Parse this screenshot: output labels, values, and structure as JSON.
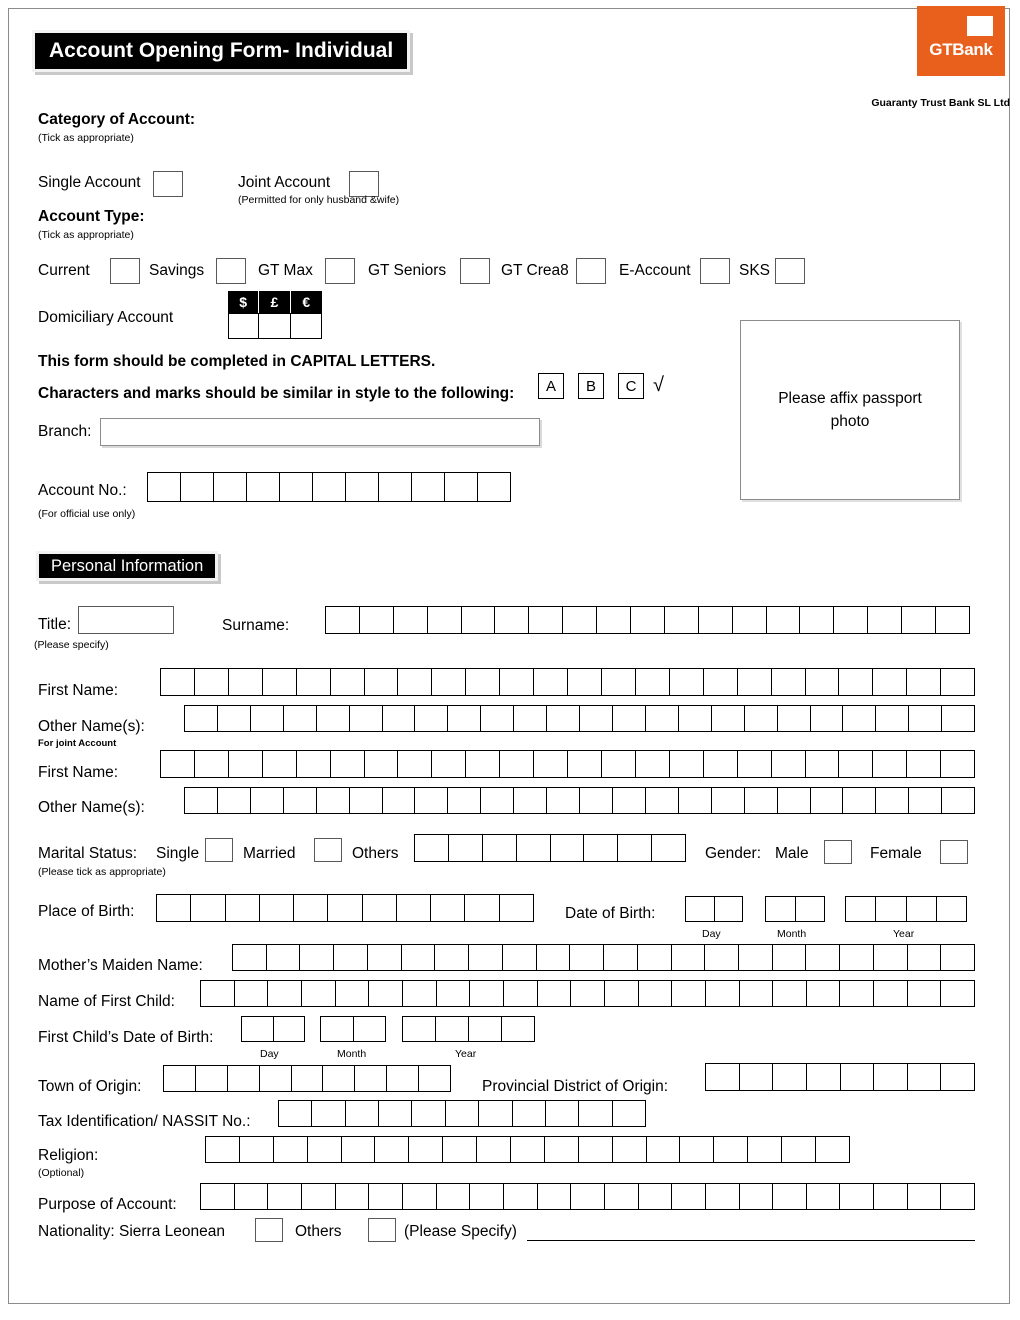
{
  "header": {
    "title": "Account Opening Form- Individual",
    "logo_text": "GTBank",
    "logo_color": "#e8601c",
    "bank_legal_name": "Guaranty Trust Bank SL Ltd"
  },
  "category": {
    "label": "Category of Account:",
    "hint": "(Tick as appropriate)",
    "single_label": "Single Account",
    "joint_label": "Joint Account",
    "joint_note": "(Permitted for only husband &wife)"
  },
  "account_type": {
    "label": "Account Type:",
    "hint": "(Tick as appropriate)",
    "options": [
      "Current",
      "Savings",
      "GT Max",
      "GT Seniors",
      "GT Crea8",
      "E-Account",
      "SKS"
    ],
    "domiciliary_label": "Domiciliary Account",
    "currencies": [
      "$",
      "£",
      "€"
    ]
  },
  "instructions": {
    "line1": "This form should be completed in CAPITAL LETTERS.",
    "line2": "Characters and marks should be similar in style to the following:",
    "samples": [
      "A",
      "B",
      "C"
    ],
    "tick_glyph": "√"
  },
  "branch": {
    "label": "Branch:",
    "value": ""
  },
  "account_no": {
    "label": "Account No.:",
    "hint": "(For official use only)",
    "cells": 11
  },
  "passport": {
    "text": "Please affix passport photo"
  },
  "personal_information": {
    "section_title": "Personal Information",
    "title_field": {
      "label": "Title:",
      "hint": "(Please specify)",
      "value": ""
    },
    "surname": {
      "label": "Surname:",
      "cells": 19
    },
    "first_name_1": {
      "label": "First Name:",
      "cells": 24
    },
    "other_names_1": {
      "label": "Other Name(s):",
      "hint": "For joint Account",
      "cells": 24
    },
    "first_name_2": {
      "label": "First Name:",
      "cells": 24
    },
    "other_names_2": {
      "label": "Other Name(s):",
      "cells": 24
    },
    "marital_status": {
      "label": "Marital Status:",
      "hint": "(Please tick as appropriate)",
      "options": [
        "Single",
        "Married",
        "Others"
      ],
      "others_cells": 8
    },
    "gender": {
      "label": "Gender:",
      "options": [
        "Male",
        "Female"
      ]
    },
    "place_of_birth": {
      "label": "Place of Birth:",
      "cells": 11
    },
    "date_of_birth": {
      "label": "Date of Birth:",
      "day_label": "Day",
      "month_label": "Month",
      "year_label": "Year",
      "day_cells": 2,
      "month_cells": 2,
      "year_cells": 4
    },
    "mothers_maiden_name": {
      "label": "Mother’s Maiden Name:",
      "cells": 22
    },
    "name_of_first_child": {
      "label": "Name of First Child:",
      "cells": 23
    },
    "first_child_dob": {
      "label": "First Child’s Date of Birth:",
      "day_label": "Day",
      "month_label": "Month",
      "year_label": "Year",
      "day_cells": 2,
      "month_cells": 2,
      "year_cells": 4
    },
    "town_of_origin": {
      "label": "Town of Origin:",
      "cells": 9
    },
    "provincial_district": {
      "label": "Provincial District of Origin:",
      "cells": 8
    },
    "tax_id": {
      "label": "Tax Identification/ NASSIT No.:",
      "cells": 11
    },
    "religion": {
      "label": "Religion:",
      "hint": "(Optional)",
      "cells": 19
    },
    "purpose_of_account": {
      "label": "Purpose of Account:",
      "cells": 23
    },
    "nationality": {
      "label": "Nationality: Sierra Leonean",
      "others_label": "Others",
      "specify_label": "(Please Specify)",
      "specify_value": ""
    }
  }
}
